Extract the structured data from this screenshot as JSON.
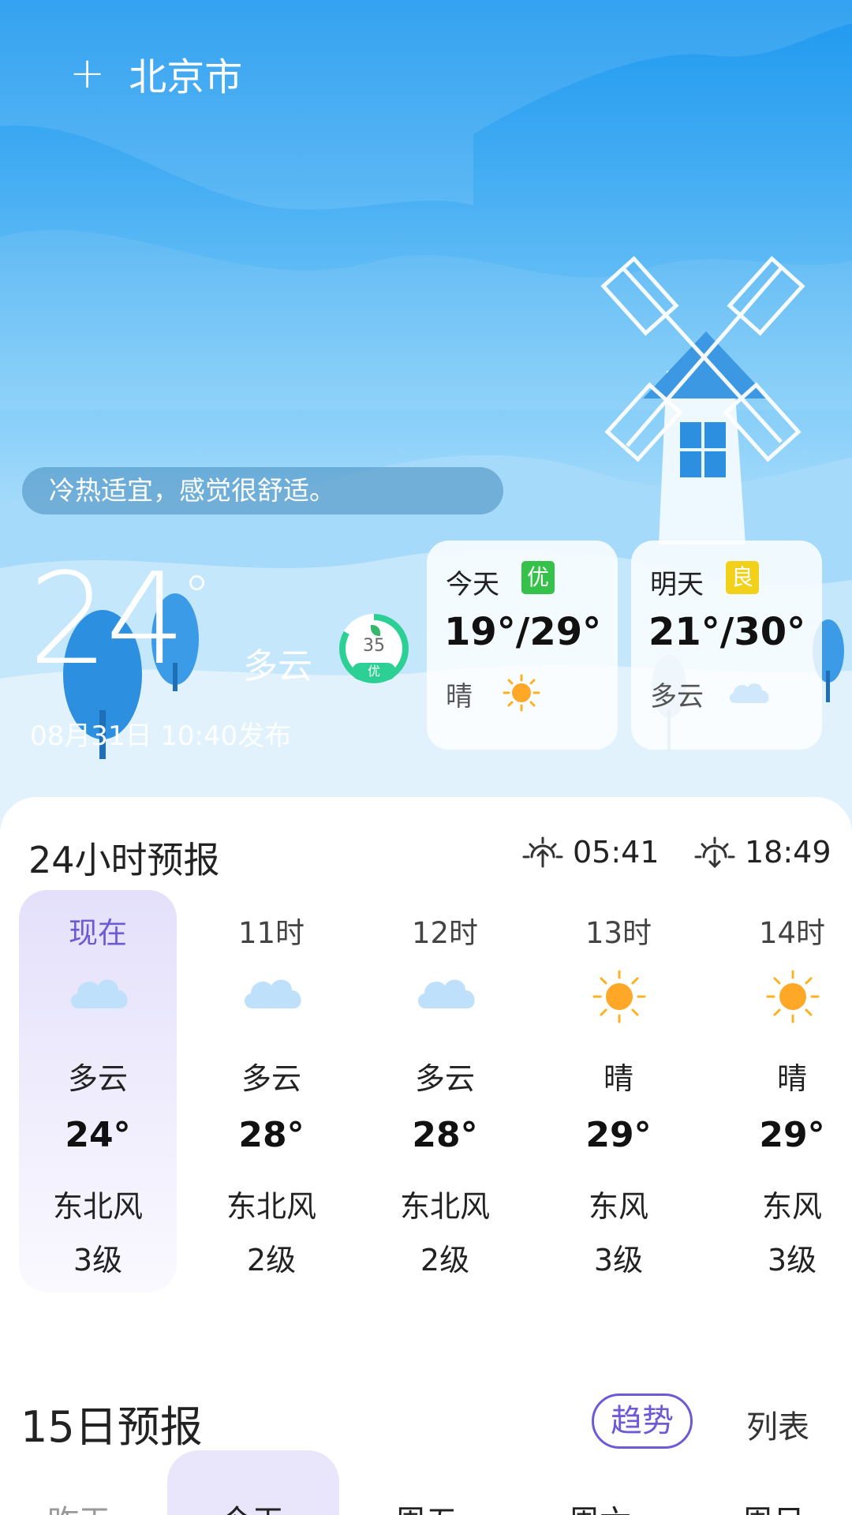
{
  "header": {
    "add_icon": "+",
    "city": "北京市"
  },
  "tip": "冷热适宜，感觉很舒适。",
  "current": {
    "temp": "24",
    "degree": "°",
    "condition": "多云",
    "aqi_value": "35",
    "aqi_label": "优",
    "publish_time": "08月31日 10:40发布"
  },
  "today_card": {
    "name": "今天",
    "badge": "优",
    "badge_color": "#35c14a",
    "range": "19°/29°",
    "condition": "晴",
    "icon": "sun-icon"
  },
  "tomorrow_card": {
    "name": "明天",
    "badge": "良",
    "badge_color": "#f2d11b",
    "range": "21°/30°",
    "condition": "多云",
    "icon": "cloud-icon"
  },
  "hourly": {
    "title": "24小时预报",
    "sunrise": "05:41",
    "sunset": "18:49",
    "items": [
      {
        "time": "现在",
        "icon": "cloud-icon",
        "condition": "多云",
        "temp": "24°",
        "wind": "东北风",
        "level": "3级"
      },
      {
        "time": "11时",
        "icon": "cloud-icon",
        "condition": "多云",
        "temp": "28°",
        "wind": "东北风",
        "level": "2级"
      },
      {
        "time": "12时",
        "icon": "cloud-icon",
        "condition": "多云",
        "temp": "28°",
        "wind": "东北风",
        "level": "2级"
      },
      {
        "time": "13时",
        "icon": "sun-icon",
        "condition": "晴",
        "temp": "29°",
        "wind": "东风",
        "level": "3级"
      },
      {
        "time": "14时",
        "icon": "sun-icon",
        "condition": "晴",
        "temp": "29°",
        "wind": "东风",
        "level": "3级"
      }
    ]
  },
  "daily": {
    "title": "15日预报",
    "trend_label": "趋势",
    "list_label": "列表",
    "tabs": [
      "昨天",
      "今天",
      "周五",
      "周六",
      "周日"
    ]
  },
  "colors": {
    "accent": "#6f5ad6",
    "aqi_green": "#2ccf94"
  }
}
